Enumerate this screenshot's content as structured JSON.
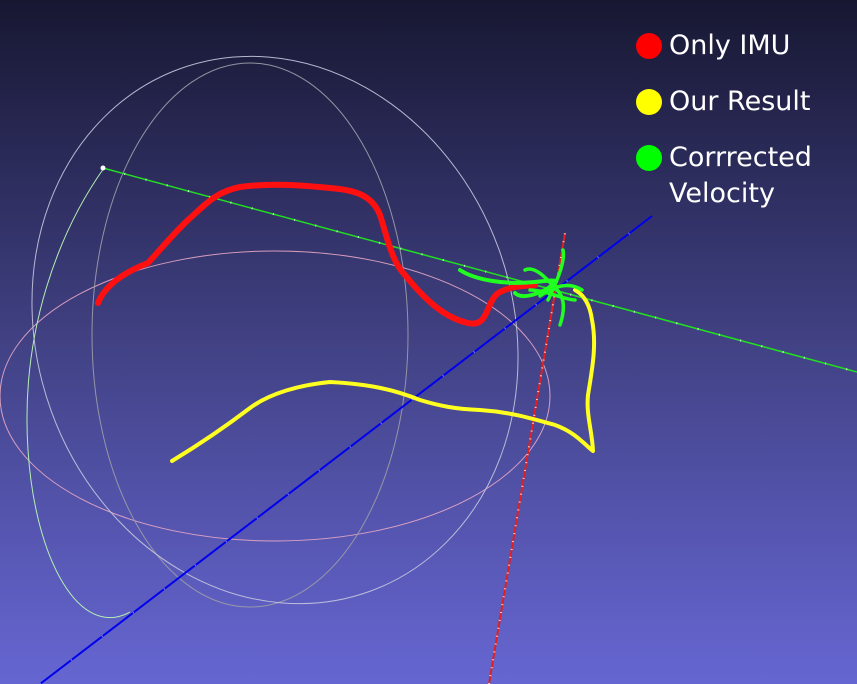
{
  "legend": {
    "items": [
      {
        "label": "Only IMU",
        "color": "#ff0000"
      },
      {
        "label": "Our Result",
        "color": "#ffff00"
      },
      {
        "label": "Corrrected\nVelocity",
        "color": "#00ff00"
      }
    ]
  },
  "colors": {
    "background_top": "#171732",
    "background_bottom": "#6666d2",
    "axis_x": "#00ff00",
    "axis_y": "#0000ff",
    "axis_z": "#ff0000",
    "trajectory_only_imu": "#ff0000",
    "trajectory_our_result": "#ffff00",
    "trajectory_corrected_velocity": "#00ff00"
  },
  "icons": {
    "trackball": "trackball-gizmo-icon"
  }
}
